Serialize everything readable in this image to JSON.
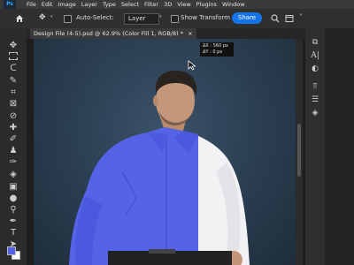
{
  "menu": [
    "File",
    "Edit",
    "Image",
    "Layer",
    "Type",
    "Select",
    "Filter",
    "3D",
    "View",
    "Plugins",
    "Window"
  ],
  "app_logo": "Ps",
  "options": {
    "auto_select_label": "Auto-Select:",
    "auto_select_value": "Layer",
    "show_transform_label": "Show Transform",
    "share_label": "Share"
  },
  "document": {
    "tab_title": "Design File (4-5).psd @ 62.9% (Color Fill 1, RGB/8) *",
    "close_glyph": "×"
  },
  "tooltip": {
    "line1": "ΔX : 560 px",
    "line2": "ΔY :   0 px"
  },
  "colors": {
    "accent": "#1473e6",
    "shirt_blue": "#5563e6",
    "shirt_white": "#f2f2f4",
    "foreground_swatch": "#5563e6",
    "background_swatch": "#ffffff"
  },
  "tools": [
    "move-icon",
    "marquee-icon",
    "lasso-icon",
    "quick-select-icon",
    "crop-icon",
    "frame-icon",
    "eyedropper-icon",
    "healing-icon",
    "brush-icon",
    "stamp-icon",
    "history-brush-icon",
    "eraser-icon",
    "gradient-icon",
    "blur-icon",
    "dodge-icon",
    "pen-icon",
    "type-icon",
    "path-select-icon",
    "shape-icon",
    "hand-icon",
    "zoom-icon"
  ]
}
